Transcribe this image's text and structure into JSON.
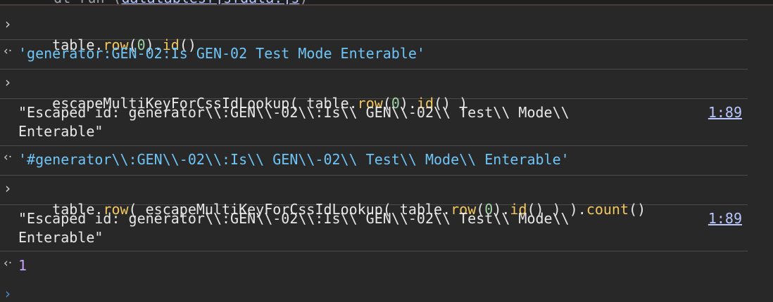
{
  "topline": {
    "fragment_a": "    dt run (",
    "fragment_link": "datatablesfjsfdata.js",
    "fragment_b": ")"
  },
  "console": [
    {
      "type": "input",
      "prompt": "›",
      "parts": [
        {
          "text": "table.",
          "kind": "plain"
        },
        {
          "text": "row",
          "kind": "fn"
        },
        {
          "text": "(",
          "kind": "plain"
        },
        {
          "text": "0",
          "kind": "num"
        },
        {
          "text": ").",
          "kind": "plain"
        },
        {
          "text": "id",
          "kind": "fn"
        },
        {
          "text": "()",
          "kind": "plain"
        }
      ]
    },
    {
      "type": "result",
      "prompt": "‹·",
      "text": "'generator:GEN-02:Is GEN-02 Test Mode Enterable'"
    },
    {
      "type": "input",
      "prompt": "›",
      "parts": [
        {
          "text": "escapeMultiKeyForCssIdLookup( table.",
          "kind": "plain"
        },
        {
          "text": "row",
          "kind": "fn"
        },
        {
          "text": "(",
          "kind": "plain"
        },
        {
          "text": "0",
          "kind": "num"
        },
        {
          "text": ").",
          "kind": "plain"
        },
        {
          "text": "id",
          "kind": "fn"
        },
        {
          "text": "() )",
          "kind": "plain"
        }
      ]
    },
    {
      "type": "log",
      "text_line1": "\"Escaped id: generator\\\\:GEN\\\\-02\\\\:Is\\\\ GEN\\\\-02\\\\ Test\\\\ Mode\\\\",
      "text_line2": "Enterable\"",
      "link": "1:89"
    },
    {
      "type": "result",
      "prompt": "‹·",
      "text": "'#generator\\\\:GEN\\\\-02\\\\:Is\\\\ GEN\\\\-02\\\\ Test\\\\ Mode\\\\ Enterable'"
    },
    {
      "type": "input",
      "prompt": "›",
      "parts": [
        {
          "text": "table.",
          "kind": "plain"
        },
        {
          "text": "row",
          "kind": "fn"
        },
        {
          "text": "( escapeMultiKeyForCssIdLookup( table.",
          "kind": "plain"
        },
        {
          "text": "row",
          "kind": "fn"
        },
        {
          "text": "(",
          "kind": "plain"
        },
        {
          "text": "0",
          "kind": "num"
        },
        {
          "text": ").",
          "kind": "plain"
        },
        {
          "text": "id",
          "kind": "fn"
        },
        {
          "text": "() ) ).",
          "kind": "plain"
        },
        {
          "text": "count",
          "kind": "fn"
        },
        {
          "text": "()",
          "kind": "plain"
        }
      ]
    },
    {
      "type": "log",
      "text_line1": "\"Escaped id: generator\\\\:GEN\\\\-02\\\\:Is\\\\ GEN\\\\-02\\\\ Test\\\\ Mode\\\\",
      "text_line2": "Enterable\"",
      "link": "1:89"
    },
    {
      "type": "result_number",
      "prompt": "‹·",
      "text": "1"
    },
    {
      "type": "prompt_empty",
      "prompt": "›"
    }
  ]
}
